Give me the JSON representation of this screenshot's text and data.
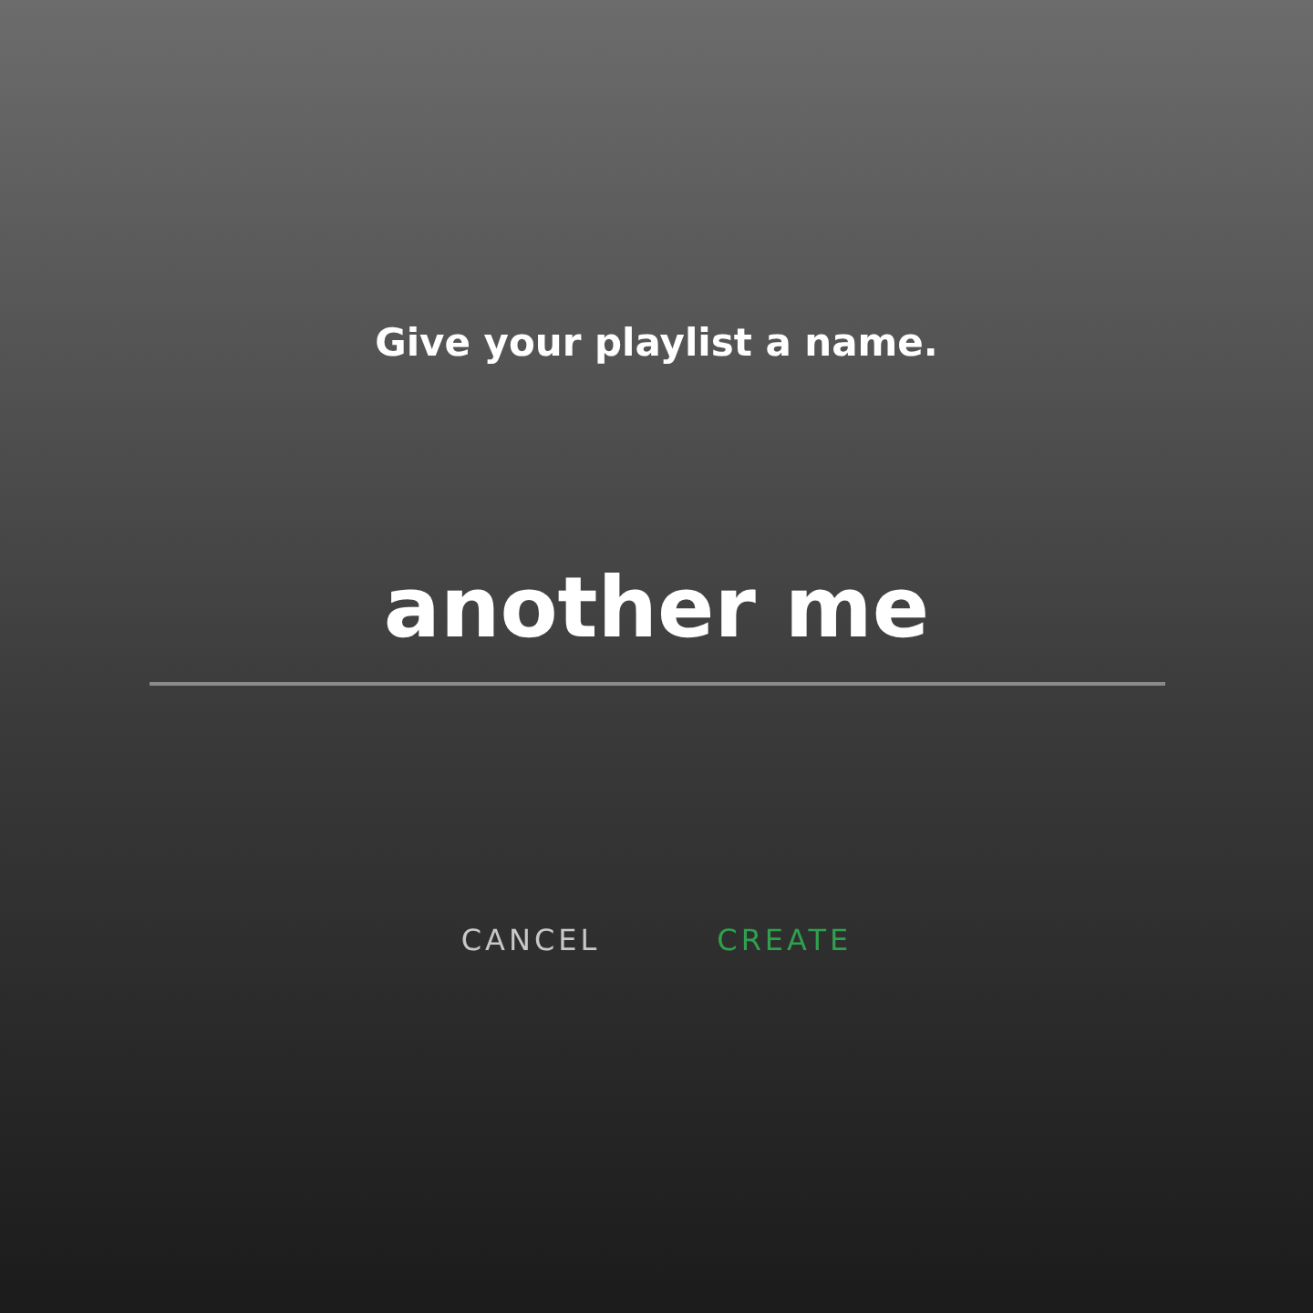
{
  "title": "Give your playlist a name.",
  "name_field": {
    "value": "another me"
  },
  "buttons": [
    {
      "label": "CANCEL",
      "kind": "cancel"
    },
    {
      "label": "CREATE",
      "kind": "confirm"
    }
  ]
}
